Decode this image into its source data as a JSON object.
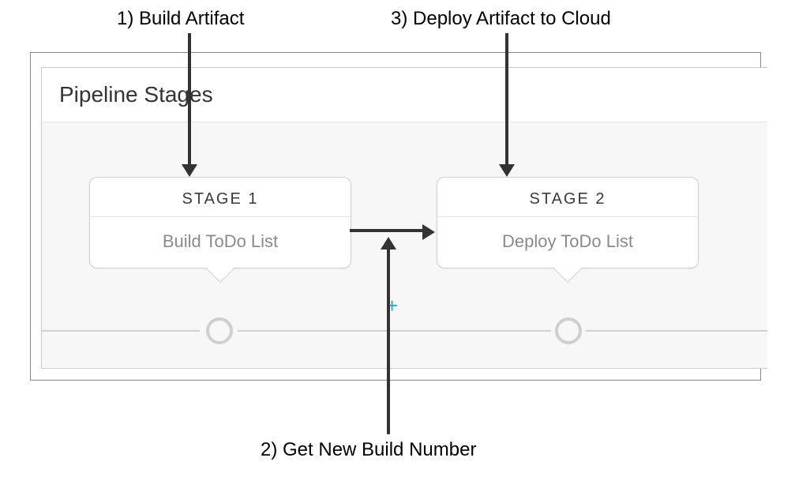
{
  "annotations": {
    "a1": "1) Build Artifact",
    "a2": "2) Get New Build Number",
    "a3": "3) Deploy Artifact to Cloud"
  },
  "panel": {
    "title": "Pipeline Stages"
  },
  "stages": [
    {
      "label": "STAGE 1",
      "name": "Build ToDo List"
    },
    {
      "label": "STAGE 2",
      "name": "Deploy ToDo List"
    }
  ],
  "icons": {
    "plus": "+"
  }
}
